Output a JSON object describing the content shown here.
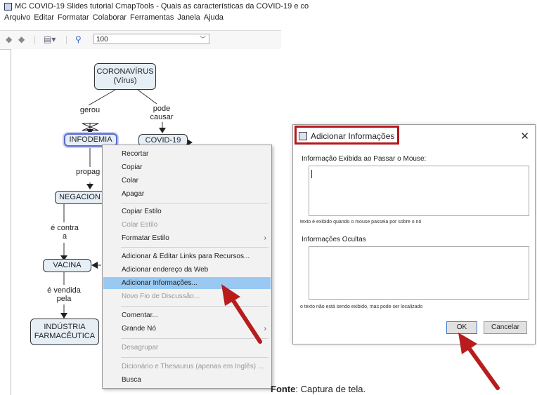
{
  "window": {
    "title": "MC COVID-19 Slides tutorial CmapTools - Quais as características da COVID-19 e co",
    "menu": [
      "Arquivo",
      "Editar",
      "Formatar",
      "Colaborar",
      "Ferramentas",
      "Janela",
      "Ajuda"
    ]
  },
  "toolbar": {
    "zoom_value": "100"
  },
  "map": {
    "nodes": {
      "coronavirus": "CORONAVÍRUS",
      "coronavirus_sub": "(Vírus)",
      "infodemia": "INFODEMIA",
      "covid": "COVID-19",
      "negacion": "NEGACION",
      "vacina": "VACINA",
      "industria_1": "INDÚSTRIA",
      "industria_2": "FARMACÊUTICA"
    },
    "links": {
      "gerou": "gerou",
      "pode_causar_1": "pode",
      "pode_causar_2": "causar",
      "propag": "propag",
      "e_contra_1": "é contra",
      "e_contra_2": "a",
      "e_vendida_1": "é vendida",
      "e_vendida_2": "pela"
    }
  },
  "context_menu": {
    "items": [
      {
        "label": "Recortar",
        "disabled": false
      },
      {
        "label": "Copiar",
        "disabled": false
      },
      {
        "label": "Colar",
        "disabled": false
      },
      {
        "label": "Apagar",
        "disabled": false
      },
      {
        "label": "Copiar Estilo",
        "disabled": false
      },
      {
        "label": "Colar Estilo",
        "disabled": true
      },
      {
        "label": "Formatar Estilo",
        "disabled": false,
        "submenu": true
      },
      {
        "label": "Adicionar & Editar Links para Recursos...",
        "disabled": false
      },
      {
        "label": "Adicionar endereço da Web",
        "disabled": false
      },
      {
        "label": "Adicionar Informações...",
        "disabled": false,
        "highlighted": true
      },
      {
        "label": "Novo Fio de Discussão...",
        "disabled": true
      },
      {
        "label": "Comentar...",
        "disabled": false
      },
      {
        "label": "Grande Nó",
        "disabled": false,
        "submenu": true
      },
      {
        "label": "Desagrupar",
        "disabled": true
      },
      {
        "label": "Dicionário e Thesaurus (apenas em Inglês) ...",
        "disabled": true
      },
      {
        "label": "Busca",
        "disabled": false
      }
    ],
    "submenu_glyph": "›"
  },
  "dialog": {
    "title": "Adicionar Informações",
    "close": "✕",
    "label_hover": "Informação Exibida ao Passar o Mouse:",
    "hint_hover": "texto é exibido quando o mouse passeia por sobre o nó",
    "label_hidden": "Informações Ocultas",
    "hint_hidden": "o texto não está sendo exibido, mas pode ser localizado",
    "ok": "OK",
    "cancel": "Cancelar"
  },
  "caption": {
    "bold": "Fonte",
    "rest": ": Captura de tela."
  },
  "colors": {
    "arrow": "#b81c1c",
    "highlight": "#99c9f2",
    "title_box": "#b4161b"
  }
}
